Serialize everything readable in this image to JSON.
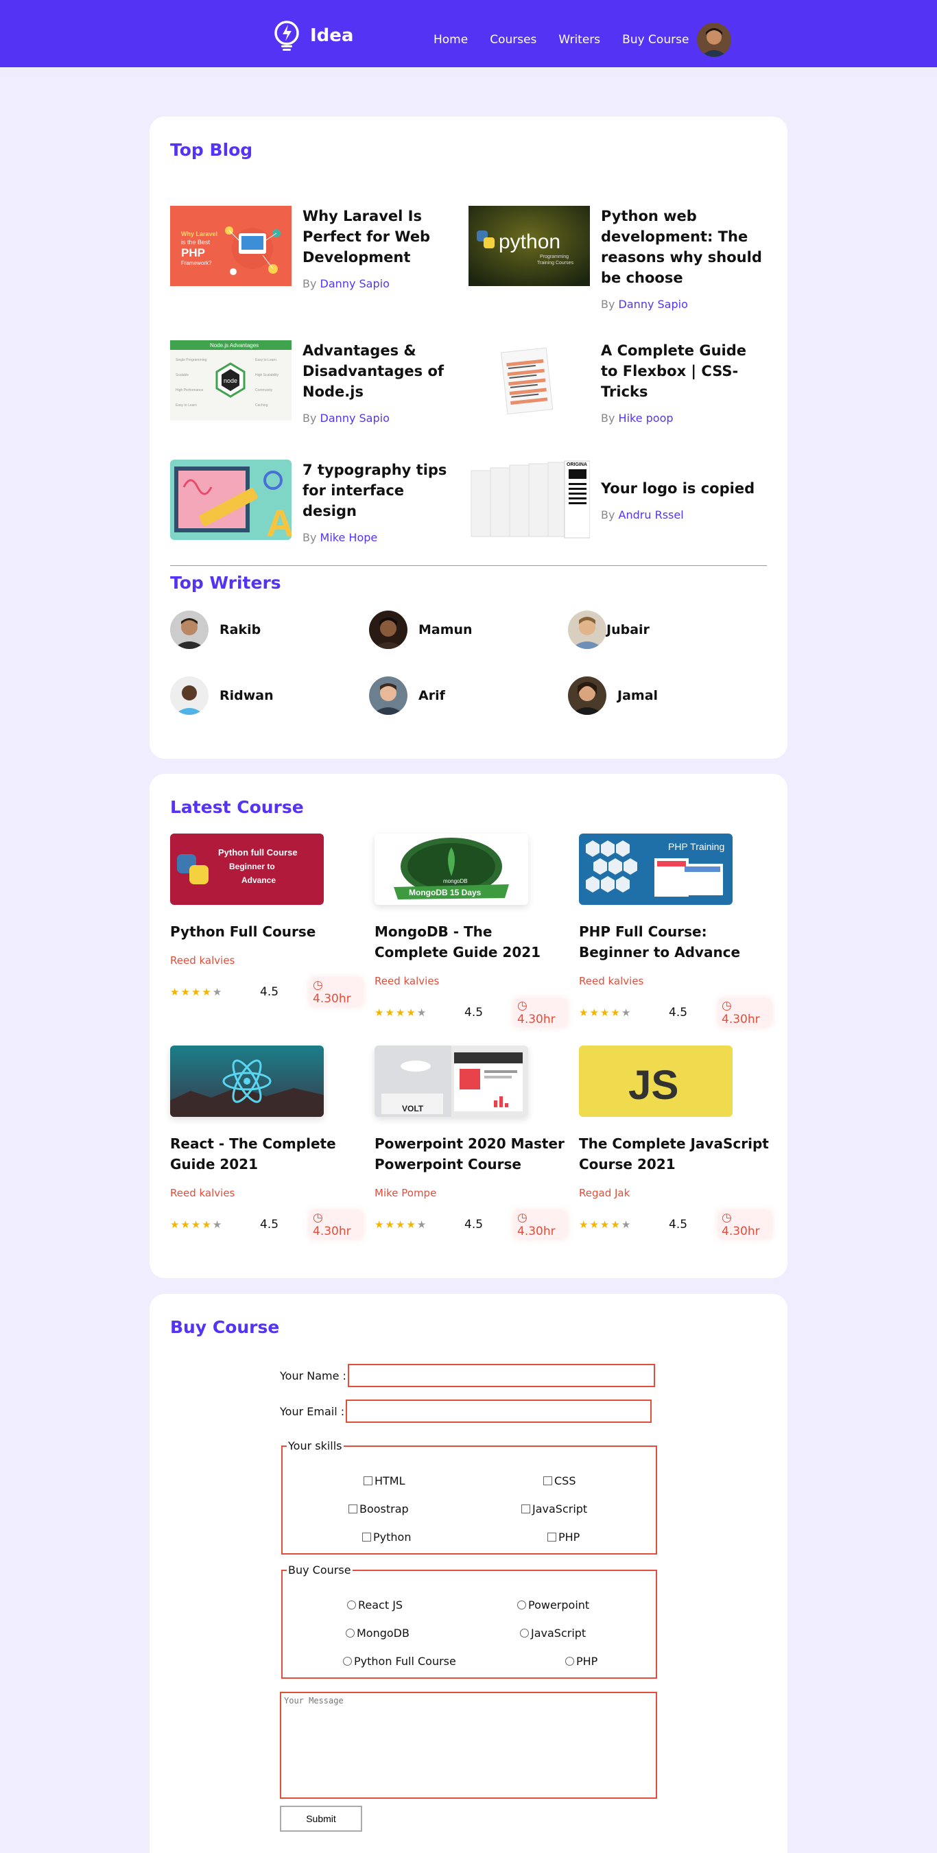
{
  "nav": {
    "brand": "Idea",
    "links": [
      "Home",
      "Courses",
      "Writers",
      "Buy Course"
    ]
  },
  "top_blog": {
    "title": "Top Blog",
    "posts": [
      {
        "title": "Why Laravel Is Perfect for Web Development",
        "by": "By",
        "author": "Danny Sapio",
        "thumb_text": "Why Laravel is the Best PHP Framework?"
      },
      {
        "title": "Python web development: The reasons why should be choose",
        "by": "By",
        "author": "Danny Sapio",
        "thumb_text": "python"
      },
      {
        "title": "Advantages & Disadvantages of Node.js",
        "by": "By",
        "author": "Danny Sapio",
        "thumb_text": "Node.js Advantages"
      },
      {
        "title": "A Complete Guide to Flexbox | CSS-Tricks",
        "by": "By",
        "author": "Hike poop"
      },
      {
        "title": "7 typography tips for interface design",
        "by": "By",
        "author": "Mike Hope"
      },
      {
        "title": "Your logo is copied",
        "by": "By",
        "author": "Andru Rssel",
        "thumb_text": "ORIGINA"
      }
    ]
  },
  "top_writers": {
    "title": "Top Writers",
    "writers": [
      "Rakib",
      "Mamun",
      "Jubair",
      "Ridwan",
      "Arif",
      "Jamal"
    ]
  },
  "latest_course": {
    "title": "Latest Course",
    "courses": [
      {
        "title": "Python Full Course",
        "author": "Reed kalvies",
        "rating": "4.5",
        "duration": "4.30hr",
        "thumb_text": "Python full Course Beginner to Advance"
      },
      {
        "title": "MongoDB - The Complete Guide 2021",
        "author": "Reed kalvies",
        "rating": "4.5",
        "duration": "4.30hr",
        "thumb_text": "MongoDB 15 Days"
      },
      {
        "title": "PHP Full Course: Beginner to Advance",
        "author": "Reed kalvies",
        "rating": "4.5",
        "duration": "4.30hr",
        "thumb_text": "PHP Training"
      },
      {
        "title": "React - The Complete Guide 2021",
        "author": "Reed kalvies",
        "rating": "4.5",
        "duration": "4.30hr"
      },
      {
        "title": "Powerpoint 2020 Master Powerpoint Course",
        "author": "Mike Pompe",
        "rating": "4.5",
        "duration": "4.30hr",
        "thumb_text": "VOLT"
      },
      {
        "title": "The Complete JavaScript Course 2021",
        "author": "Regad Jak",
        "rating": "4.5",
        "duration": "4.30hr",
        "thumb_text": "JS"
      }
    ]
  },
  "buy_course": {
    "title": "Buy Course",
    "name_label": "Your Name :",
    "email_label": "Your Email :",
    "skills_legend": "Your skills",
    "skills": [
      "HTML",
      "CSS",
      "Boostrap",
      "JavaScript",
      "Python",
      "PHP"
    ],
    "course_legend": "Buy Course",
    "course_options": [
      "React JS",
      "Powerpoint",
      "MongoDB",
      "JavaScript",
      "Python Full Course",
      "PHP"
    ],
    "message_placeholder": "Your Message",
    "submit": "Submit"
  },
  "colors": {
    "primary": "#5533f5",
    "background": "#f0eefe",
    "accent_red": "#e44d3a",
    "star": "#f5b400"
  }
}
